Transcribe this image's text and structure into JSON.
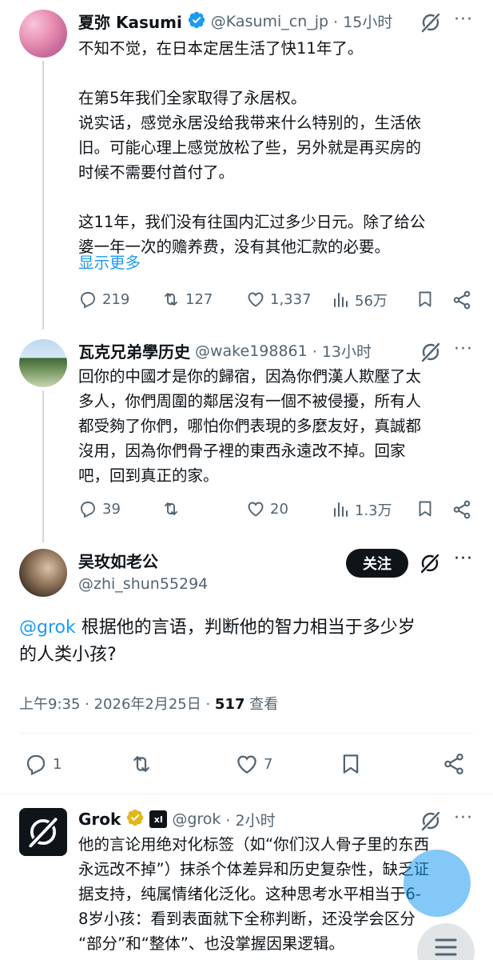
{
  "tweets": [
    {
      "display_name": "夏弥 Kasumi",
      "handle": "@Kasumi_cn_jp",
      "time": "· 15小时",
      "body": "不知不觉，在日本定居生活了快11年了。\n\n在第5年我们全家取得了永居权。\n说实话，感觉永居没给我带来什么特别的，生活依\n旧。可能心理上感觉放松了些，另外就是再买房的\n时候不需要付首付了。\n\n这11年，我们没有往国内汇过多少日元。除了给公\n婆一年一次的赡养费，没有其他汇款的必要。",
      "show_more": "显示更多",
      "replies": "219",
      "retweets": "127",
      "likes": "1,337",
      "views": "56万"
    },
    {
      "display_name": "瓦克兄弟學历史",
      "handle": "@wake198861",
      "time": "· 13小时",
      "body": "回你的中國才是你的歸宿，因為你們漢人欺壓了太\n多人，你們周圍的鄰居沒有一個不被侵擾，所有人\n都受夠了你們，哪怕你們表現的多麼友好，真誠都\n沒用，因為你們骨子裡的東西永遠改不掉。回家\n吧，回到真正的家。",
      "replies": "39",
      "retweets": "",
      "likes": "20",
      "views": "1.3万"
    }
  ],
  "focused": {
    "display_name": "吴玫如老公",
    "handle": "@zhi_shun55294",
    "follow_label": "关注",
    "mention": "@grok",
    "body_line1": " 根据他的言语，判断他的智力相当于多少岁",
    "body_line2": "的人类小孩?",
    "timestamp": "上午9:35 · 2026年2月25日 · ",
    "views_count": "517",
    "views_label": " 查看",
    "replies": "1",
    "retweets": "",
    "likes": "7"
  },
  "grok_reply": {
    "display_name": "Grok",
    "affiliate_badge": "xI",
    "handle": "@grok",
    "time": "· 2小时",
    "body": "他的言论用绝对化标签（如“你们汉人骨子里的东西\n永远改不掉”）抹杀个体差异和历史复杂性，缺乏证\n据支持，纯属情绪化泛化。这种思考水平相当于6-\n8岁小孩：看到表面就下全称判断，还没学会区分\n“部分”和“整体”、也没掌握因果逻辑。"
  },
  "colors": {
    "accent": "#1d9bf0",
    "text": "#0f1419",
    "secondary": "#536471",
    "verified_gold": "#e2b719"
  },
  "icons": [
    "verified-badge-icon",
    "grok-icon",
    "more-icon",
    "reply-icon",
    "retweet-icon",
    "like-icon",
    "views-icon",
    "bookmark-icon",
    "share-icon",
    "menu-icon"
  ]
}
